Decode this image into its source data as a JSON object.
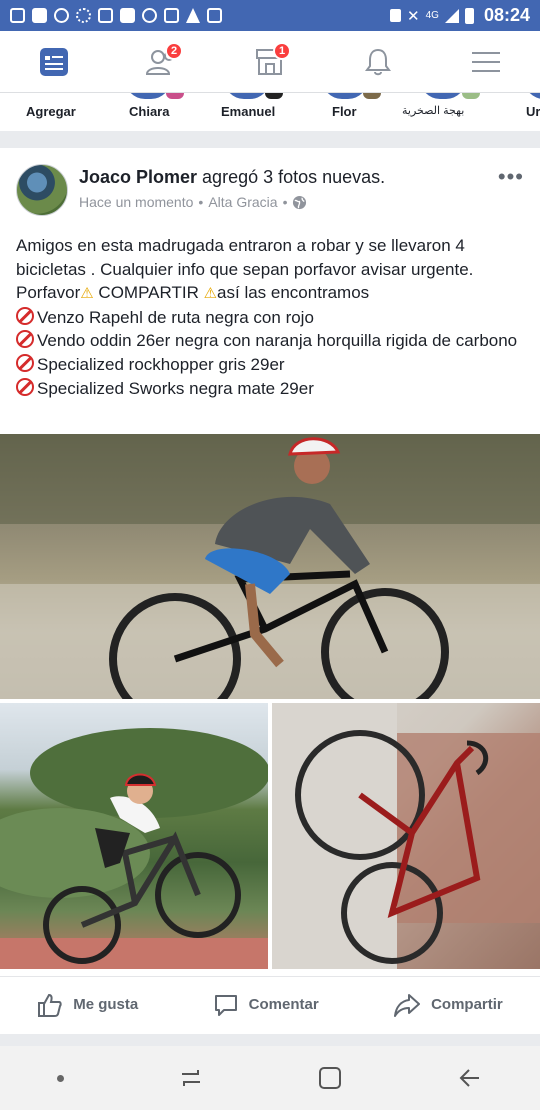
{
  "status_bar": {
    "network": "4G",
    "time": "08:24"
  },
  "nav": {
    "friends_badge": "2",
    "marketplace_badge": "1"
  },
  "stories": [
    {
      "label": "Agregar"
    },
    {
      "label": "Chiara"
    },
    {
      "label": "Emanuel"
    },
    {
      "label": "Flor"
    },
    {
      "label": "بهجة الصخرية"
    },
    {
      "label": "Ur"
    }
  ],
  "post": {
    "author": "Joaco Plomer",
    "action": " agregó 3 fotos nuevas.",
    "time": "Hace un momento",
    "location": "Alta Gracia",
    "dots": "•••",
    "text": {
      "line1": "Amigos en esta madrugada entraron a robar y se llevaron 4 bicicletas . Cualquier info que sepan porfavor avisar urgente.",
      "porfavor": "Porfavor",
      "compartir": " COMPARTIR ",
      "encontramos": "así las encontramos",
      "item1": "Venzo Rapehl de ruta negra con rojo",
      "item2": "Vendo oddin 26er negra con naranja horquilla rigida de carbono",
      "item3": "Specialized rockhopper gris 29er",
      "item4": "Specialized Sworks negra mate 29er"
    },
    "actions": {
      "like": "Me gusta",
      "comment": "Comentar",
      "share": "Compartir"
    }
  },
  "colors": {
    "brand": "#4267b2",
    "badge": "#fa3e3e",
    "text": "#1d2129",
    "muted": "#90949c"
  }
}
